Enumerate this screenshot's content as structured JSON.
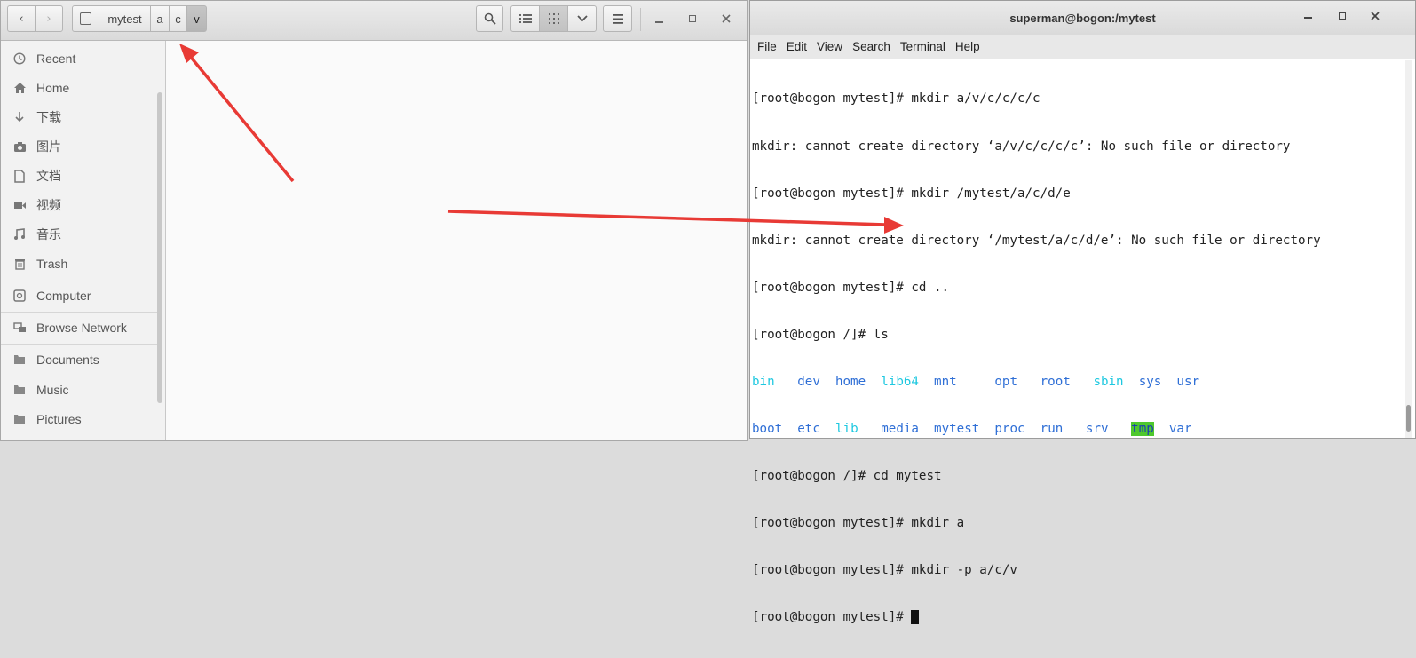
{
  "file_manager": {
    "breadcrumbs": [
      "mytest",
      "a",
      "c",
      "v"
    ],
    "sidebar": {
      "items": [
        {
          "label": "Recent",
          "icon": "clock-icon"
        },
        {
          "label": "Home",
          "icon": "home-icon"
        },
        {
          "label": "下载",
          "icon": "download-icon"
        },
        {
          "label": "图片",
          "icon": "camera-icon"
        },
        {
          "label": "文档",
          "icon": "document-icon"
        },
        {
          "label": "视频",
          "icon": "video-icon"
        },
        {
          "label": "音乐",
          "icon": "music-icon"
        },
        {
          "label": "Trash",
          "icon": "trash-icon"
        },
        {
          "label": "Computer",
          "icon": "computer-icon"
        },
        {
          "label": "Browse Network",
          "icon": "network-icon"
        },
        {
          "label": "Documents",
          "icon": "folder-icon"
        },
        {
          "label": "Music",
          "icon": "folder-icon"
        },
        {
          "label": "Pictures",
          "icon": "folder-icon"
        }
      ]
    }
  },
  "terminal": {
    "title": "superman@bogon:/mytest",
    "menu": [
      "File",
      "Edit",
      "View",
      "Search",
      "Terminal",
      "Help"
    ],
    "lines": [
      "[root@bogon mytest]# mkdir a/v/c/c/c/c",
      "mkdir: cannot create directory ‘a/v/c/c/c/c’: No such file or directory",
      "[root@bogon mytest]# mkdir /mytest/a/c/d/e",
      "mkdir: cannot create directory ‘/mytest/a/c/d/e’: No such file or directory",
      "[root@bogon mytest]# cd ..",
      "[root@bogon /]# ls"
    ],
    "ls_row1": [
      "bin",
      "dev",
      "home",
      "lib64",
      "mnt",
      "opt",
      "root",
      "sbin",
      "sys",
      "usr"
    ],
    "ls_row2": [
      "boot",
      "etc",
      "lib",
      "media",
      "mytest",
      "proc",
      "run",
      "srv",
      "tmp",
      "var"
    ],
    "lines_after": [
      "[root@bogon /]# cd mytest",
      "[root@bogon mytest]# mkdir a",
      "[root@bogon mytest]# mkdir -p a/c/v"
    ],
    "prompt": "[root@bogon mytest]# "
  },
  "colors": {
    "annotation_arrow": "#e83a35",
    "ls_cyan": "#1ec8e0",
    "ls_blue": "#2f6fd6",
    "tmp_highlight": "#4ec82d"
  }
}
